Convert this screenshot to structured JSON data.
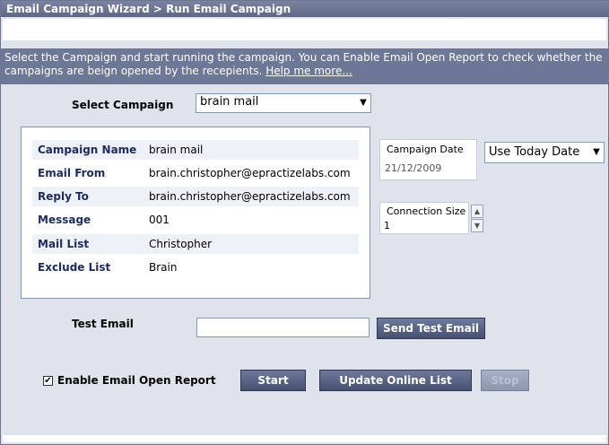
{
  "title": "Email Campaign Wizard > Run Email Campaign",
  "info": {
    "text": "Select the Campaign and start running the campaign. You can Enable Email Open Report to check whether the campaigns are beign opened by the recepients. ",
    "help_link": "Help me more..."
  },
  "select_campaign": {
    "label": "Select Campaign",
    "value": "brain mail"
  },
  "details": [
    {
      "key": "Campaign Name",
      "value": "brain mail"
    },
    {
      "key": "Email From",
      "value": "brain.christopher@epractizelabs.com"
    },
    {
      "key": "Reply To",
      "value": "brain.christopher@epractizelabs.com"
    },
    {
      "key": "Message",
      "value": "001"
    },
    {
      "key": "Mail List",
      "value": "Christopher"
    },
    {
      "key": "Exclude List",
      "value": "Brain"
    }
  ],
  "campaign_date": {
    "label": "Campaign Date",
    "value": "21/12/2009",
    "option": "Use Today Date"
  },
  "connection_size": {
    "label": "Connection Size",
    "value": "1"
  },
  "test_email": {
    "label": "Test Email",
    "value": "",
    "send_label": "Send Test Email"
  },
  "enable_report": {
    "label": "Enable Email Open Report",
    "checked": true,
    "check_glyph": "✔"
  },
  "buttons": {
    "start": "Start",
    "update": "Update Online List",
    "stop": "Stop"
  },
  "icons": {
    "dropdown": "▼",
    "spin_up": "▲",
    "spin_down": "▼"
  }
}
